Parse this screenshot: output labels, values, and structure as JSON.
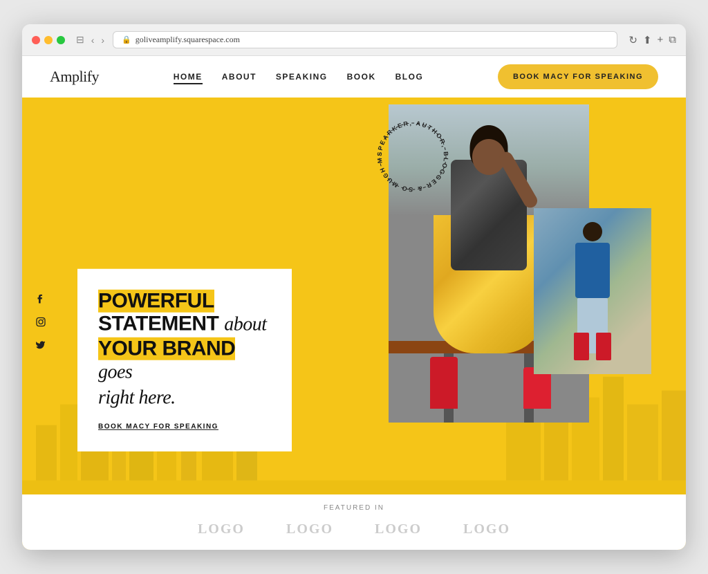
{
  "browser": {
    "url": "goliveamplify.squarespace.com",
    "reload_icon": "↻"
  },
  "nav": {
    "logo": "Amplify",
    "links": [
      {
        "label": "HOME",
        "active": true
      },
      {
        "label": "ABOUT",
        "active": false
      },
      {
        "label": "SPEAKING",
        "active": false
      },
      {
        "label": "BOOK",
        "active": false
      },
      {
        "label": "BLOG",
        "active": false
      }
    ],
    "cta_label": "BOOK MACY FOR SPEAKING"
  },
  "hero": {
    "headline_line1": "POWERFUL",
    "headline_line2": "STATEMENT",
    "headline_italic1": "about",
    "headline_line3": "YOUR BRAND",
    "headline_italic2": "goes",
    "headline_italic3": "right here.",
    "cta_link": "BOOK MACY FOR SPEAKING",
    "badge_text": "SPEARKER, AUTHOR, BLOGGER & SO MUCH MORE.",
    "social": {
      "facebook": "f",
      "instagram": "◯",
      "twitter": "🐦"
    }
  },
  "featured": {
    "label": "FEATURED IN",
    "logos": [
      "LOGO",
      "LOGO",
      "LOGO",
      "LOGO"
    ]
  }
}
